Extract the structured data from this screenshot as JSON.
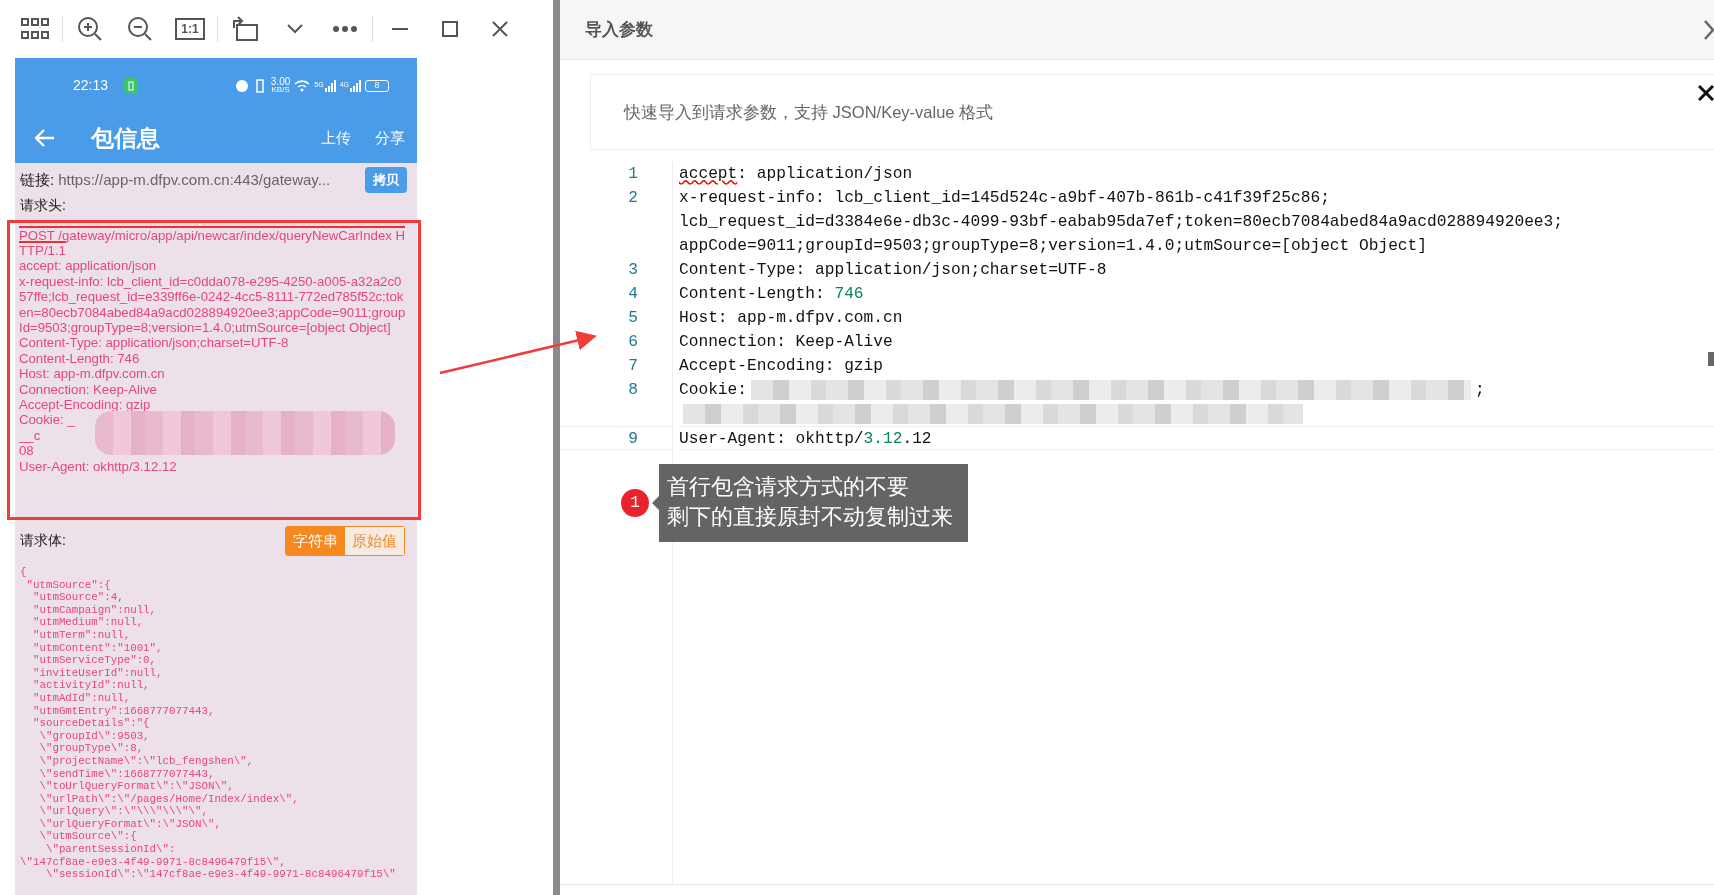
{
  "viewer_toolbar": {
    "actual_size_label": "1:1"
  },
  "phone": {
    "status_bar": {
      "time": "22:13",
      "speed": "3.00",
      "speed_unit": "KB/S",
      "networks": [
        "5G",
        "4G"
      ],
      "battery": "8"
    },
    "app_bar": {
      "title": "包信息",
      "actions": [
        "上传",
        "分享"
      ]
    },
    "link": {
      "label": "链接:",
      "url": "https://app-m.dfpv.com.cn:443/gateway...",
      "copy_button": "拷贝"
    },
    "headers_label": "请求头:",
    "headers": [
      {
        "text": "POST /gateway/micro/app/api/newcar/index/queryNewCarIndex HTTP/1.1",
        "struck": true
      },
      {
        "text": "accept: application/json",
        "struck": false
      },
      {
        "text": "x-request-info: lcb_client_id=c0dda078-e295-4250-a005-a32a2c057ffe;lcb_request_id=e339ff6e-0242-4cc5-8111-772ed785f52c;token=80ecb7084abed84a9acd028894920ee3;appCode=9011;groupId=9503;groupType=8;version=1.4.0;utmSource=[object Object]",
        "struck": false
      },
      {
        "text": "Content-Type: application/json;charset=UTF-8",
        "struck": false
      },
      {
        "text": "Content-Length: 746",
        "struck": false
      },
      {
        "text": "Host: app-m.dfpv.com.cn",
        "struck": false
      },
      {
        "text": "Connection: Keep-Alive",
        "struck": false
      },
      {
        "text": "Accept-Encoding: gzip",
        "struck": false
      },
      {
        "text": "Cookie: _",
        "struck": false
      },
      {
        "text": "__c",
        "struck": false
      },
      {
        "text": "08",
        "struck": false
      },
      {
        "text": "User-Agent: okhttp/3.12.12",
        "struck": false
      }
    ],
    "body_label": "请求体:",
    "body_modes": [
      {
        "label": "字符串",
        "selected": true
      },
      {
        "label": "原始值",
        "selected": false
      }
    ],
    "body_lines": [
      "{",
      " \"utmSource\":{",
      "  \"utmSource\":4,",
      "  \"utmCampaign\":null,",
      "  \"utmMedium\":null,",
      "  \"utmTerm\":null,",
      "  \"utmContent\":\"1001\",",
      "  \"utmServiceType\":0,",
      "  \"inviteUserId\":null,",
      "  \"activityId\":null,",
      "  \"utmAdId\":null,",
      "  \"utmGmtEntry\":1668777077443,",
      "  \"sourceDetails\":\"{",
      "   \\\"groupId\\\":9503,",
      "   \\\"groupType\\\":8,",
      "   \\\"projectName\\\":\\\"lcb_fengshen\\\",",
      "   \\\"sendTime\\\":1668777077443,",
      "   \\\"toUrlQueryFormat\\\":\\\"JSON\\\",",
      "   \\\"urlPath\\\":\\\"/pages/Home/Index/index\\\",",
      "   \\\"urlQuery\\\":\\\"\\\\\\\"\\\\\\\"\\\",",
      "   \\\"urlQueryFormat\\\":\\\"JSON\\\",",
      "   \\\"utmSource\\\":{",
      "    \\\"parentSessionId\\\":",
      "\\\"147cf8ae-e9e3-4f49-9971-8c8496479f15\\\",",
      "    \\\"sessionId\\\":\\\"147cf8ae-e9e3-4f49-9971-8c8496479f15\\\""
    ]
  },
  "dialog": {
    "title": "导入参数",
    "hint": "快速导入到请求参数，支持 JSON/Key-value 格式",
    "editor_lines": [
      {
        "number": "1",
        "rows": [
          [
            {
              "kind": "misspelled",
              "text": "accept"
            },
            {
              "kind": "plain",
              "text": ": application/json"
            }
          ]
        ]
      },
      {
        "number": "2",
        "rows": [
          [
            {
              "kind": "plain",
              "text": "x-request-info: lcb_client_id=145d524c-a9bf-407b-861b-c41f39f25c86;"
            }
          ],
          [
            {
              "kind": "plain",
              "text": "lcb_request_id=d3384e6e-db3c-4099-93bf-eabab95da7ef;token=80ecb7084abed84a9acd028894920ee3;"
            }
          ],
          [
            {
              "kind": "plain",
              "text": "appCode=9011;groupId=9503;groupType=8;version=1.4.0;utmSource=[object Object]"
            }
          ]
        ]
      },
      {
        "number": "3",
        "rows": [
          [
            {
              "kind": "plain",
              "text": "Content-Type: application/json;charset=UTF-8"
            }
          ]
        ]
      },
      {
        "number": "4",
        "rows": [
          [
            {
              "kind": "plain",
              "text": "Content-Length: "
            },
            {
              "kind": "number",
              "text": "746"
            }
          ]
        ]
      },
      {
        "number": "5",
        "rows": [
          [
            {
              "kind": "plain",
              "text": "Host: app-m.dfpv.com.cn"
            }
          ]
        ]
      },
      {
        "number": "6",
        "rows": [
          [
            {
              "kind": "plain",
              "text": "Connection: Keep-Alive"
            }
          ]
        ]
      },
      {
        "number": "7",
        "rows": [
          [
            {
              "kind": "plain",
              "text": "Accept-Encoding: gzip"
            }
          ]
        ]
      },
      {
        "number": "8",
        "rows": [
          [
            {
              "kind": "plain",
              "text": "Cookie:"
            },
            {
              "kind": "redacted"
            },
            {
              "kind": "plain",
              "text": ";"
            }
          ],
          [
            {
              "kind": "redacted"
            }
          ]
        ]
      },
      {
        "number": "9",
        "rows": [
          [
            {
              "kind": "plain",
              "text": "User-Agent: okhttp/"
            },
            {
              "kind": "number",
              "text": "3.12"
            },
            {
              "kind": "plain",
              "text": ".12"
            }
          ]
        ]
      }
    ]
  },
  "annotation": {
    "badge": "1",
    "lines": [
      "首行包含请求方式的不要",
      "剩下的直接原封不动复制过来"
    ]
  }
}
